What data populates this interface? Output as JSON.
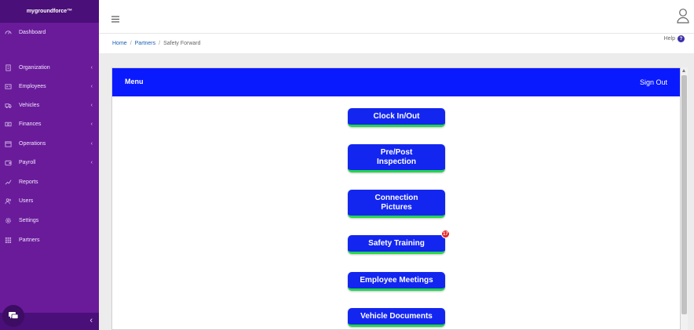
{
  "brand": "mygroundforce™",
  "sidebar": {
    "items": [
      {
        "label": "Dashboard",
        "icon": "dashboard-icon",
        "chevron": ""
      },
      {
        "label": "Organization",
        "icon": "building-icon",
        "chevron": "‹"
      },
      {
        "label": "Employees",
        "icon": "id-card-icon",
        "chevron": "‹"
      },
      {
        "label": "Vehicles",
        "icon": "truck-icon",
        "chevron": "‹"
      },
      {
        "label": "Finances",
        "icon": "money-icon",
        "chevron": "‹"
      },
      {
        "label": "Operations",
        "icon": "calendar-icon",
        "chevron": "‹"
      },
      {
        "label": "Payroll",
        "icon": "wallet-icon",
        "chevron": "‹"
      },
      {
        "label": "Reports",
        "icon": "chart-line-icon",
        "chevron": ""
      },
      {
        "label": "Users",
        "icon": "users-icon",
        "chevron": ""
      },
      {
        "label": "Settings",
        "icon": "gear-icon",
        "chevron": ""
      },
      {
        "label": "Partners",
        "icon": "grid-icon",
        "chevron": ""
      }
    ],
    "collapse_glyph": "‹"
  },
  "breadcrumb": {
    "home": "Home",
    "partners": "Partners",
    "current": "Safety Forward",
    "separator": "/"
  },
  "help_label": "Help",
  "help_glyph": "?",
  "panel": {
    "title": "Menu",
    "signout": "Sign Out"
  },
  "menu": {
    "clock": "Clock In/Out",
    "inspection_line1": "Pre/Post",
    "inspection_line2": "Inspection",
    "pictures_line1": "Connection",
    "pictures_line2": "Pictures",
    "training": "Safety Training",
    "training_badge": "17",
    "meetings": "Employee Meetings",
    "documents": "Vehicle Documents"
  },
  "colors": {
    "sidebar": "#6a1b9a",
    "header_blue": "#0a1aff",
    "button_blue": "#1326f0",
    "button_accent": "#22d64a",
    "badge_red": "#e52020"
  }
}
